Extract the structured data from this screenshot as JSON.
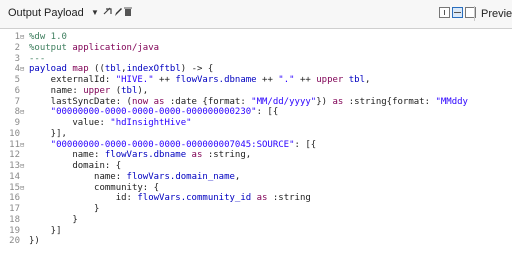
{
  "toolbar": {
    "output_label": "Output",
    "payload_label": "Payload",
    "preview_label": "Preview"
  },
  "icons": [
    "dropdown-arrow-icon",
    "add-icon",
    "edit-icon",
    "delete-icon"
  ],
  "colors": {
    "keyword": "#7f0055",
    "string": "#2a00ff",
    "variable": "#0000c0",
    "comment": "#3f7f5f",
    "active_view": "#2a6ebd"
  },
  "editor": {
    "lines": [
      {
        "n": "1",
        "fold": "⊟",
        "parts": [
          {
            "c": "cm",
            "t": "%dw 1.0"
          }
        ]
      },
      {
        "n": "2",
        "fold": "",
        "parts": [
          {
            "c": "cm",
            "t": "%output "
          },
          {
            "c": "kw",
            "t": "application/java"
          }
        ]
      },
      {
        "n": "3",
        "fold": "",
        "parts": [
          {
            "c": "cm",
            "t": "---"
          }
        ]
      },
      {
        "n": "4",
        "fold": "⊟",
        "parts": [
          {
            "c": "var",
            "t": "payload"
          },
          {
            "c": "kw",
            "t": " map "
          },
          {
            "c": "pl",
            "t": "(("
          },
          {
            "c": "var",
            "t": "tbl"
          },
          {
            "c": "pl",
            "t": ","
          },
          {
            "c": "var",
            "t": "indexOftbl"
          },
          {
            "c": "pl",
            "t": ") -> {"
          }
        ]
      },
      {
        "n": "5",
        "fold": "",
        "parts": [
          {
            "c": "pl",
            "t": "    externalId: "
          },
          {
            "c": "str",
            "t": "\"HIVE.\""
          },
          {
            "c": "pl",
            "t": " ++ "
          },
          {
            "c": "var",
            "t": "flowVars.dbname"
          },
          {
            "c": "pl",
            "t": " ++ "
          },
          {
            "c": "str",
            "t": "\".\""
          },
          {
            "c": "pl",
            "t": " ++ "
          },
          {
            "c": "kw",
            "t": "upper"
          },
          {
            "c": "pl",
            "t": " "
          },
          {
            "c": "var",
            "t": "tbl"
          },
          {
            "c": "pl",
            "t": ","
          }
        ]
      },
      {
        "n": "6",
        "fold": "",
        "parts": [
          {
            "c": "pl",
            "t": "    name: "
          },
          {
            "c": "kw",
            "t": "upper"
          },
          {
            "c": "pl",
            "t": " ("
          },
          {
            "c": "var",
            "t": "tbl"
          },
          {
            "c": "pl",
            "t": "),"
          }
        ]
      },
      {
        "n": "7",
        "fold": "",
        "parts": [
          {
            "c": "pl",
            "t": "    lastSyncDate: ("
          },
          {
            "c": "kw",
            "t": "now as"
          },
          {
            "c": "pl",
            "t": " :date {format: "
          },
          {
            "c": "str",
            "t": "\"MM/dd/yyyy\""
          },
          {
            "c": "pl",
            "t": "}) "
          },
          {
            "c": "kw",
            "t": "as"
          },
          {
            "c": "pl",
            "t": " :string{format: "
          },
          {
            "c": "str",
            "t": "\"MMddy"
          }
        ]
      },
      {
        "n": "8",
        "fold": "⊟",
        "parts": [
          {
            "c": "str",
            "t": "    \"00000000-0000-0000-0000-000000000230\""
          },
          {
            "c": "pl",
            "t": ": [{"
          }
        ]
      },
      {
        "n": "9",
        "fold": "",
        "parts": [
          {
            "c": "pl",
            "t": "        value: "
          },
          {
            "c": "str",
            "t": "\"hdInsightHive\""
          }
        ]
      },
      {
        "n": "10",
        "fold": "",
        "parts": [
          {
            "c": "pl",
            "t": "    }],"
          }
        ]
      },
      {
        "n": "11",
        "fold": "⊟",
        "parts": [
          {
            "c": "str",
            "t": "    \"00000000-0000-0000-0000-000000007045:SOURCE\""
          },
          {
            "c": "pl",
            "t": ": [{"
          }
        ]
      },
      {
        "n": "12",
        "fold": "",
        "parts": [
          {
            "c": "pl",
            "t": "        name: "
          },
          {
            "c": "var",
            "t": "flowVars.dbname"
          },
          {
            "c": "kw",
            "t": " as"
          },
          {
            "c": "pl",
            "t": " :string,"
          }
        ]
      },
      {
        "n": "13",
        "fold": "⊟",
        "parts": [
          {
            "c": "pl",
            "t": "        domain: {"
          }
        ]
      },
      {
        "n": "14",
        "fold": "",
        "parts": [
          {
            "c": "pl",
            "t": "            name: "
          },
          {
            "c": "var",
            "t": "flowVars.domain_name"
          },
          {
            "c": "pl",
            "t": ","
          }
        ]
      },
      {
        "n": "15",
        "fold": "⊟",
        "parts": [
          {
            "c": "pl",
            "t": "            community: {"
          }
        ]
      },
      {
        "n": "16",
        "fold": "",
        "parts": [
          {
            "c": "pl",
            "t": "                id: "
          },
          {
            "c": "var",
            "t": "flowVars.community_id"
          },
          {
            "c": "kw",
            "t": " as"
          },
          {
            "c": "pl",
            "t": " :string"
          }
        ]
      },
      {
        "n": "17",
        "fold": "",
        "parts": [
          {
            "c": "pl",
            "t": "            }"
          }
        ]
      },
      {
        "n": "18",
        "fold": "",
        "parts": [
          {
            "c": "pl",
            "t": "        }"
          }
        ]
      },
      {
        "n": "19",
        "fold": "",
        "parts": [
          {
            "c": "pl",
            "t": "    }]"
          }
        ]
      },
      {
        "n": "20",
        "fold": "",
        "parts": [
          {
            "c": "pl",
            "t": "})"
          }
        ]
      }
    ]
  }
}
